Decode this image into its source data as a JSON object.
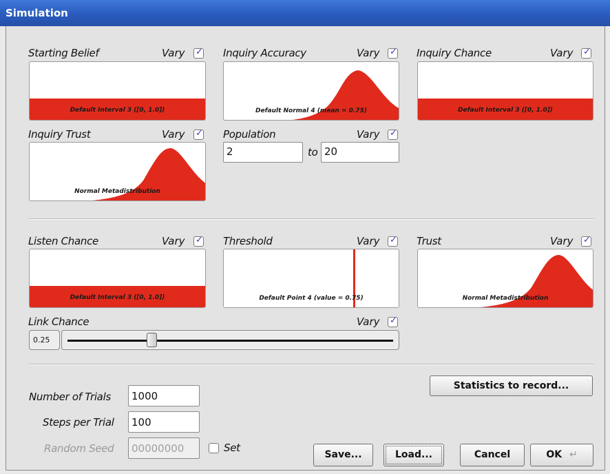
{
  "window": {
    "title": "Simulation"
  },
  "vary_label": "Vary",
  "to_label": "to",
  "panels": {
    "starting_belief": {
      "label": "Starting Belief",
      "vary": true,
      "caption": "Default Interval 3 ([0, 1.0])"
    },
    "inquiry_accuracy": {
      "label": "Inquiry Accuracy",
      "vary": true,
      "caption": "Default Normal 4 (mean = 0.75)"
    },
    "inquiry_chance": {
      "label": "Inquiry Chance",
      "vary": true,
      "caption": "Default Interval 3 ([0, 1.0])"
    },
    "inquiry_trust": {
      "label": "Inquiry Trust",
      "vary": true,
      "caption": "Normal Metadistribution"
    },
    "population": {
      "label": "Population",
      "vary": true,
      "from": "2",
      "to": "20"
    },
    "listen_chance": {
      "label": "Listen Chance",
      "vary": true,
      "caption": "Default Interval 3 ([0, 1.0])"
    },
    "threshold": {
      "label": "Threshold",
      "vary": true,
      "caption": "Default Point 4 (value = 0.75)"
    },
    "trust": {
      "label": "Trust",
      "vary": true,
      "caption": "Normal Metadistribution"
    },
    "link_chance": {
      "label": "Link Chance",
      "vary": true,
      "value": "0.25",
      "slider_fraction": 0.25
    }
  },
  "trials": {
    "number_label": "Number of Trials",
    "number_value": "1000",
    "steps_label": "Steps per Trial",
    "steps_value": "100",
    "seed_label": "Random Seed",
    "seed_value": "00000000",
    "set_label": "Set",
    "set_checked": false
  },
  "buttons": {
    "statistics": "Statistics to record...",
    "save": "Save...",
    "load": "Load...",
    "cancel": "Cancel",
    "ok": "OK"
  },
  "colors": {
    "fill": "#e02a1c",
    "titlebar": "#2a5bbd"
  }
}
